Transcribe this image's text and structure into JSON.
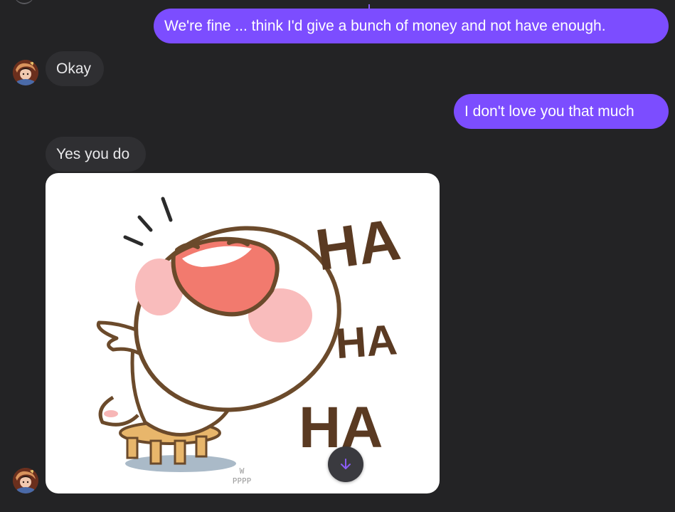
{
  "messages": [
    {
      "direction": "out",
      "text": "We're fine ... think I'd give a bunch of money and not have enough."
    },
    {
      "direction": "in",
      "text": "Okay"
    },
    {
      "direction": "out",
      "text": "I don't love you that much"
    },
    {
      "direction": "in",
      "text": "Yes you do"
    },
    {
      "direction": "in",
      "type": "sticker"
    }
  ],
  "sticker": {
    "text_ha_1": "HA",
    "text_ha_2": "HA",
    "text_ha_3": "HA",
    "watermark_line1": "W",
    "watermark_line2": "PPPP"
  },
  "scroll_button": {
    "icon": "arrow-down-icon"
  },
  "colors": {
    "background": "#232325",
    "outgoing_bubble": "#7c4dff",
    "incoming_bubble": "#2f2f32",
    "accent": "#8b5cf6"
  }
}
